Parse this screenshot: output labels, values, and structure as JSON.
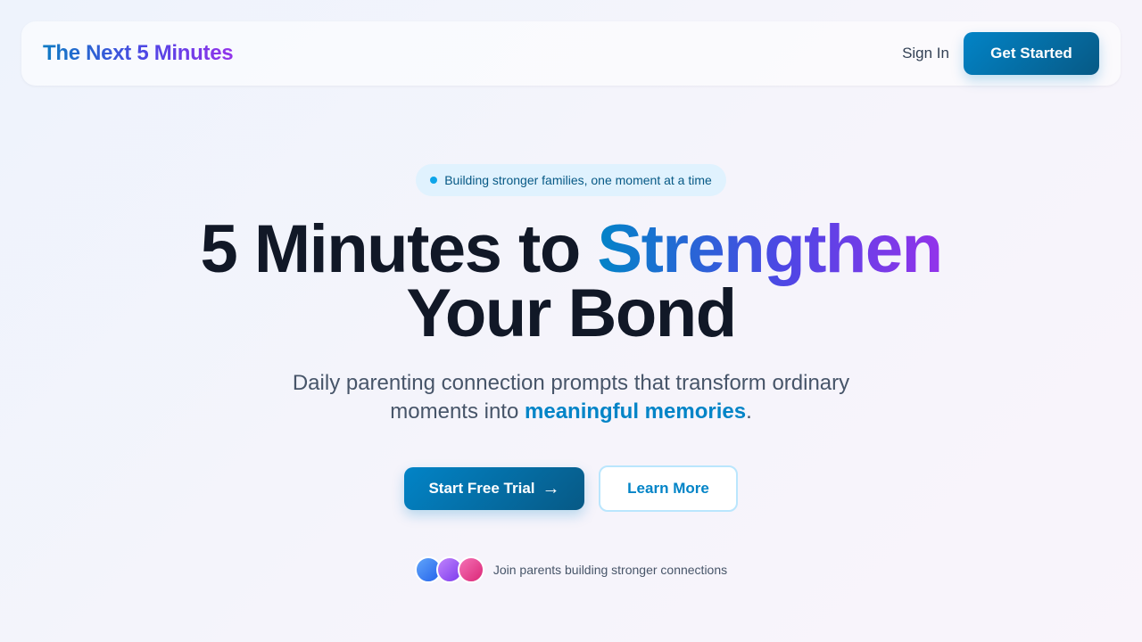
{
  "nav": {
    "logo": "The Next 5 Minutes",
    "sign_in": "Sign In",
    "get_started": "Get Started"
  },
  "hero": {
    "badge": "Building stronger families, one moment at a time",
    "headline_part1": "5 Minutes to",
    "headline_highlight": "Strengthen",
    "headline_part2": "Your Bond",
    "subtitle_part1": "Daily parenting connection prompts that transform ordinary moments into",
    "subtitle_highlight": "meaningful memories",
    "subtitle_end": ".",
    "primary_cta": "Start Free Trial",
    "primary_cta_icon": "→",
    "secondary_cta": "Learn More",
    "social_proof": "Join parents building stronger connections"
  },
  "colors": {
    "accent": "#0284c7",
    "accent_dark": "#075985",
    "gradient_end": "#9333ea",
    "heading": "#111827",
    "body_text": "#475569"
  }
}
